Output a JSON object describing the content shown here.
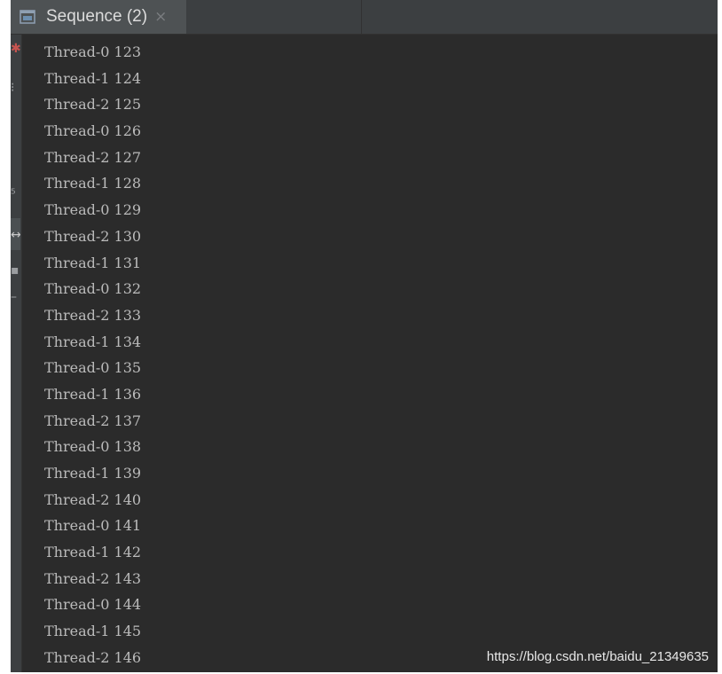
{
  "tab": {
    "icon": "console-window-icon",
    "label": "Sequence (2)",
    "close_glyph": "×"
  },
  "gutter": {
    "icons": [
      "pin-icon",
      "settings-icon",
      "step-icon",
      "wrap-icon",
      "print-icon",
      "clear-icon"
    ]
  },
  "console": {
    "lines": [
      "Thread-0 123",
      "Thread-1 124",
      "Thread-2 125",
      "Thread-0 126",
      "Thread-2 127",
      "Thread-1 128",
      "Thread-0 129",
      "Thread-2 130",
      "Thread-1 131",
      "Thread-0 132",
      "Thread-2 133",
      "Thread-1 134",
      "Thread-0 135",
      "Thread-1 136",
      "Thread-2 137",
      "Thread-0 138",
      "Thread-1 139",
      "Thread-2 140",
      "Thread-0 141",
      "Thread-1 142",
      "Thread-2 143",
      "Thread-0 144",
      "Thread-1 145",
      "Thread-2 146"
    ]
  },
  "watermark": "https://blog.csdn.net/baidu_21349635",
  "colors": {
    "background": "#2b2b2b",
    "tab_active": "#4e5254",
    "text": "#bbbbbb",
    "gutter_accent": "#c75450"
  }
}
